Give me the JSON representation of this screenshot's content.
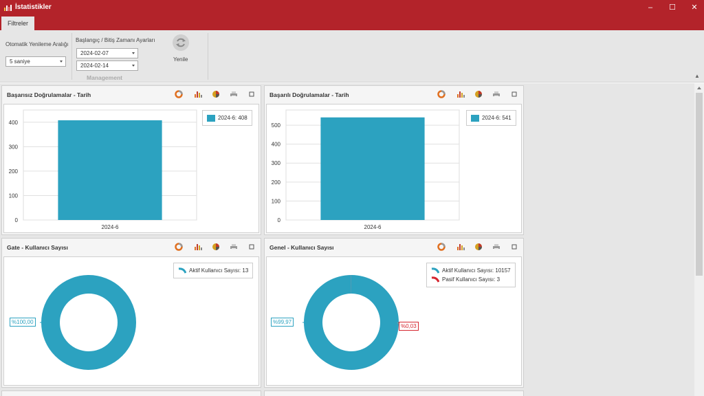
{
  "window": {
    "title": "İstatistikler",
    "controls": [
      "–",
      "☐",
      "✕"
    ]
  },
  "ribbon": {
    "tab": "Filtreler",
    "refresh_interval_label": "Otomatik Yenileme Aralığı",
    "refresh_interval_value": "5 saniye",
    "date_range_label": "Başlangıç / Bitiş Zamanı Ayarları",
    "start_date": "2024-02-07",
    "end_date": "2024-02-14",
    "refresh_button": "Yenile",
    "group_label": "Management"
  },
  "colors": {
    "titlebar": "#b3232a",
    "series_teal": "#2ca2c0",
    "series_red": "#d5252f"
  },
  "panels": [
    {
      "title": "Başarısız Doğrulamalar - Tarih",
      "chart_data": {
        "type": "bar",
        "categories": [
          "2024-6"
        ],
        "series": [
          {
            "name": "2024-6",
            "values": [
              408
            ]
          }
        ],
        "ylim": [
          0,
          450
        ],
        "yticks": [
          0,
          100,
          200,
          300,
          400
        ],
        "legend": [
          "2024-6: 408"
        ]
      }
    },
    {
      "title": "Başarılı Doğrulamalar - Tarih",
      "chart_data": {
        "type": "bar",
        "categories": [
          "2024-6"
        ],
        "series": [
          {
            "name": "2024-6",
            "values": [
              541
            ]
          }
        ],
        "ylim": [
          0,
          580
        ],
        "yticks": [
          0,
          100,
          200,
          300,
          400,
          500
        ],
        "legend": [
          "2024-6: 541"
        ]
      }
    },
    {
      "title": "Gate - Kullanıcı Sayısı",
      "chart_data": {
        "type": "pie",
        "slices": [
          {
            "name": "Aktif Kullanıcı Sayısı",
            "value": 13,
            "label": "%100,00"
          }
        ],
        "legend": [
          "Aktif Kullanıcı Sayısı: 13"
        ]
      }
    },
    {
      "title": "Genel - Kullanıcı Sayısı",
      "chart_data": {
        "type": "pie",
        "slices": [
          {
            "name": "Aktif Kullanıcı Sayısı",
            "value": 10157,
            "label": "%99,97"
          },
          {
            "name": "Pasif Kullanıcı Sayısı",
            "value": 3,
            "label": "%0,03"
          }
        ],
        "legend": [
          "Aktif Kullanıcı Sayısı: 10157",
          "Pasif Kullanıcı Sayısı: 3"
        ]
      }
    }
  ]
}
